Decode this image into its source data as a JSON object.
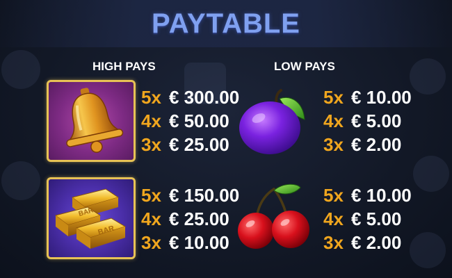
{
  "title": "PAYTABLE",
  "sections": {
    "high": "HIGH PAYS",
    "low": "LOW PAYS"
  },
  "symbols": {
    "bell": {
      "icon": "bell-icon",
      "pays": [
        {
          "mult": "5x",
          "amount": "€ 300.00"
        },
        {
          "mult": "4x",
          "amount": "€ 50.00"
        },
        {
          "mult": "3x",
          "amount": "€ 25.00"
        }
      ]
    },
    "gold_bar": {
      "icon": "gold-bar-icon",
      "bar_text": "BAR",
      "pays": [
        {
          "mult": "5x",
          "amount": "€ 150.00"
        },
        {
          "mult": "4x",
          "amount": "€ 25.00"
        },
        {
          "mult": "3x",
          "amount": "€ 10.00"
        }
      ]
    },
    "plum": {
      "icon": "plum-icon",
      "pays": [
        {
          "mult": "5x",
          "amount": "€ 10.00"
        },
        {
          "mult": "4x",
          "amount": "€ 5.00"
        },
        {
          "mult": "3x",
          "amount": "€ 2.00"
        }
      ]
    },
    "cherry": {
      "icon": "cherry-icon",
      "pays": [
        {
          "mult": "5x",
          "amount": "€ 10.00"
        },
        {
          "mult": "4x",
          "amount": "€ 5.00"
        },
        {
          "mult": "3x",
          "amount": "€ 2.00"
        }
      ]
    }
  },
  "colors": {
    "title": "#7fa0f0",
    "multiplier": "#f0a61e",
    "amount": "#ffffff",
    "card_border": "#e7c255",
    "bell_card_bg": "#7e2b84",
    "bar_card_bg": "#4a2ea8"
  }
}
